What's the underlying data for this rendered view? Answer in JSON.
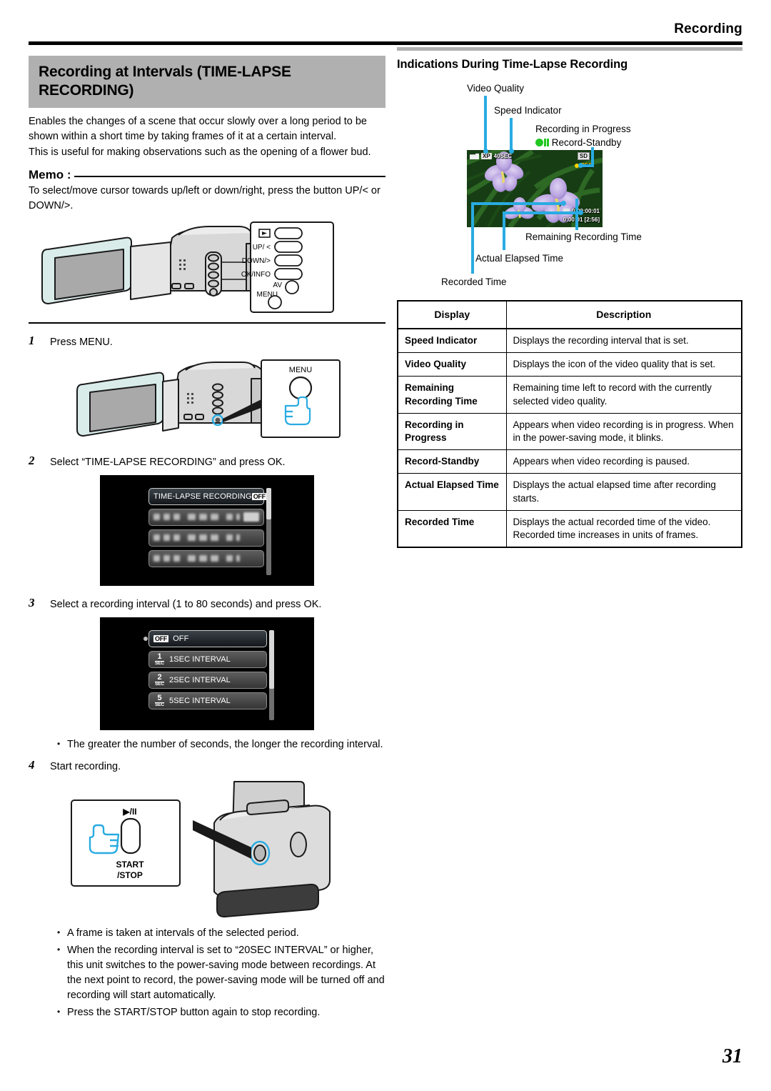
{
  "header": {
    "section": "Recording",
    "page_number": "31"
  },
  "left": {
    "title": "Recording at Intervals (TIME-LAPSE RECORDING)",
    "intro_1": "Enables the changes of a scene that occur slowly over a long period to be shown within a short time by taking frames of it at a certain interval.",
    "intro_2": "This is useful for making observations such as the opening of a flower bud.",
    "memo_label": "Memo :",
    "memo_text": "To select/move cursor towards up/left or down/right, press the button UP/< or DOWN/>.",
    "button_panel": {
      "play_icon": "▶",
      "up": "UP/ <",
      "down": "DOWN/>",
      "ok_info": "OK/INFO",
      "av": "AV",
      "menu": "MENU"
    },
    "menu_callout_label": "MENU",
    "startstop_callout": {
      "icon": "▶/II",
      "line1": "START",
      "line2": "/STOP"
    },
    "steps": [
      {
        "num": "1",
        "text": "Press MENU."
      },
      {
        "num": "2",
        "text": "Select “TIME-LAPSE RECORDING” and press OK."
      },
      {
        "num": "3",
        "text": "Select a recording interval (1 to 80 seconds) and press OK."
      },
      {
        "num": "4",
        "text": "Start recording."
      }
    ],
    "menu_screen_1": {
      "selected_row_label": "TIME-LAPSE RECORDING",
      "selected_row_badge": "OFF"
    },
    "menu_screen_2": {
      "rows": [
        {
          "icon_num": "",
          "icon_sub": "",
          "badge": "OFF",
          "label": "OFF",
          "selected": true
        },
        {
          "icon_num": "1",
          "icon_sub": "SEC",
          "badge": "",
          "label": "1SEC INTERVAL",
          "selected": false
        },
        {
          "icon_num": "2",
          "icon_sub": "SEC",
          "badge": "",
          "label": "2SEC INTERVAL",
          "selected": false
        },
        {
          "icon_num": "5",
          "icon_sub": "SEC",
          "badge": "",
          "label": "5SEC INTERVAL",
          "selected": false
        }
      ]
    },
    "note_after_step3": "The greater the number of seconds, the longer the recording interval.",
    "final_bullets": [
      "A frame is taken at intervals of the selected period.",
      "When the recording interval is set to “20SEC INTERVAL” or higher, this unit switches to the power-saving mode between recordings. At the next point to record, the power-saving mode will be turned off and recording will start automatically.",
      "Press the START/STOP button again to stop recording."
    ]
  },
  "right": {
    "sub_title": "Indications During Time-Lapse Recording",
    "callouts": {
      "video_quality": "Video Quality",
      "speed_indicator": "Speed Indicator",
      "recording_in_progress": "Recording in Progress",
      "record_standby": "Record-Standby",
      "remaining_recording_time": "Remaining Recording Time",
      "actual_elapsed_time": "Actual Elapsed Time",
      "recorded_time": "Recorded Time"
    },
    "lcd_osd": {
      "quality_badge": "XP",
      "speed": "40SEC",
      "card_badge": "SD",
      "rec": "REC",
      "recorded_time": "0:00:00:01",
      "elapsed_time": "0:00:01",
      "remaining_time": "[2:56]"
    },
    "table": {
      "columns": [
        "Display",
        "Description"
      ],
      "rows": [
        {
          "display": "Speed Indicator",
          "description": "Displays the recording interval that is set."
        },
        {
          "display": "Video Quality",
          "description": "Displays the icon of the video quality that is set."
        },
        {
          "display": "Remaining Recording Time",
          "description": "Remaining time left to record with the currently selected video quality."
        },
        {
          "display": "Recording in Progress",
          "description": "Appears when video recording is in progress. When in the power-saving mode, it blinks."
        },
        {
          "display": "Record-Standby",
          "description": "Appears when video recording is paused."
        },
        {
          "display": "Actual Elapsed Time",
          "description": "Displays the actual elapsed time after recording starts."
        },
        {
          "display": "Recorded Time",
          "description": "Displays the actual recorded time of the video. Recorded time increases in units of frames."
        }
      ]
    }
  },
  "colors": {
    "accent_cyan": "#29abe2",
    "standby_green": "#22c722",
    "band_gray": "#b0b0b0"
  }
}
